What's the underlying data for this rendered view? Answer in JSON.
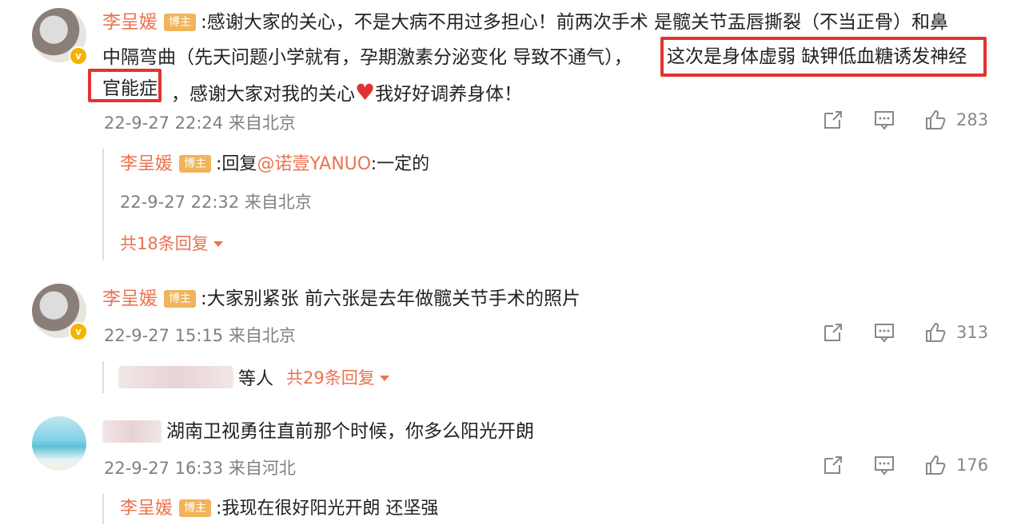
{
  "comments": [
    {
      "author": "李呈媛",
      "tag": "博主",
      "text_line1": ":感谢大家的关心，不是大病不用过多担心！前两次手术 是髋关节盂唇撕裂（不当正骨）和鼻",
      "text_line2_a": "中隔弯曲（先天问题小学就有，孕期激素分泌变化 导致不通气），",
      "text_line2_b": "这次是身体虚弱 缺钾低血糖诱发神经",
      "text_line3_a": "官能症",
      "text_line3_b": "，感谢大家对我的关心",
      "text_line3_c": "我好好调养身体！",
      "time": "22-9-27 22:24 来自北京",
      "likes": "283",
      "reply": {
        "author": "李呈媛",
        "tag": "博主",
        "prefix": ":回复",
        "mention": "@诺壹YANUO",
        "text": ":一定的",
        "time": "22-9-27 22:32 来自北京"
      },
      "more": "共18条回复"
    },
    {
      "author": "李呈媛",
      "tag": "博主",
      "text": ":大家别紧张 前六张是去年做髋关节手术的照片",
      "time": "22-9-27 15:15 来自北京",
      "likes": "313",
      "others": "等人",
      "more": "共29条回复"
    },
    {
      "text": "湖南卫视勇往直前那个时候，你多么阳光开朗",
      "time": "22-9-27 16:33 来自河北",
      "likes": "176",
      "reply": {
        "author": "李呈媛",
        "tag": "博主",
        "text": ":我现在很好阳光开朗 还坚强"
      }
    }
  ],
  "icons": {
    "share": "share-icon",
    "comment": "comment-icon",
    "like": "thumbs-up-icon",
    "verified": "verified-badge-icon",
    "heart": "heart-icon"
  },
  "colors": {
    "name": "#eb7350",
    "highlight_box": "#e23333",
    "tag_bg": "#f0b45a"
  }
}
